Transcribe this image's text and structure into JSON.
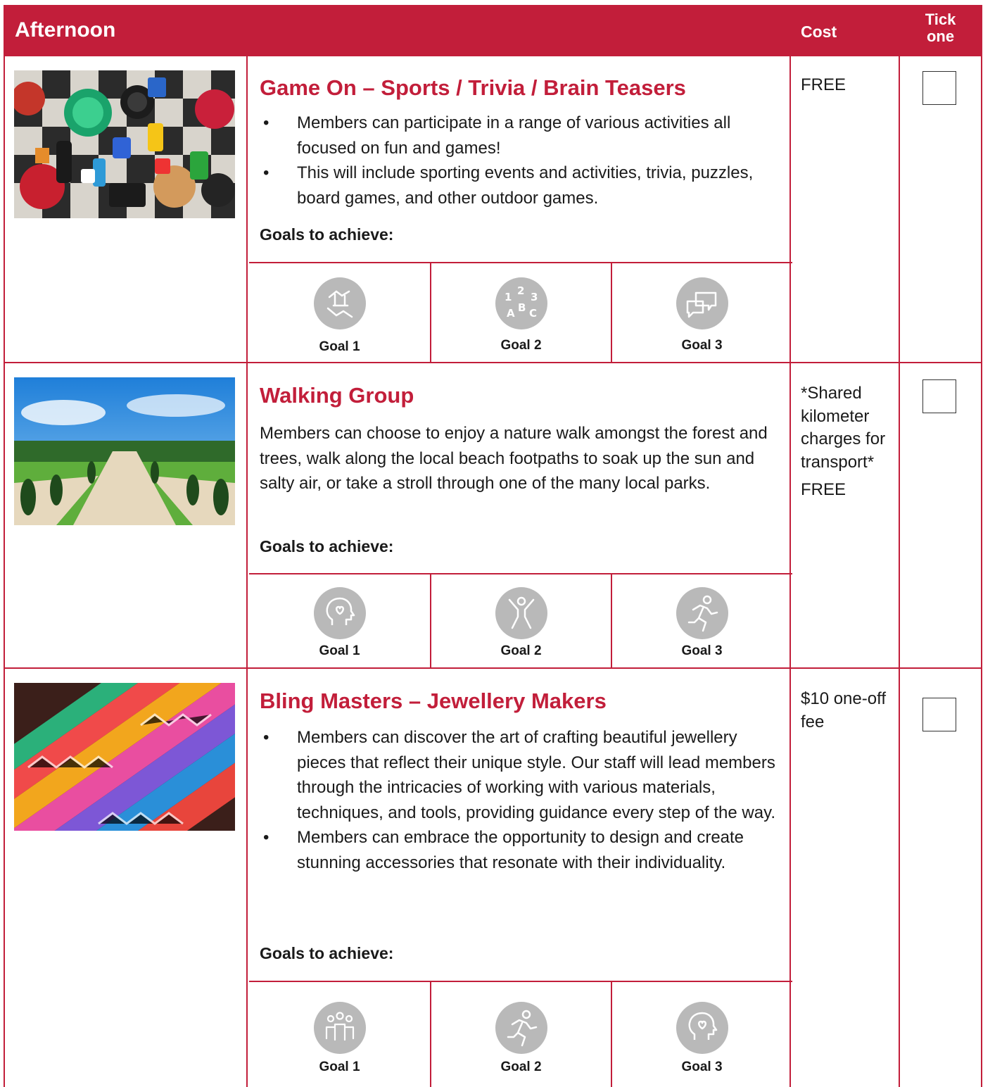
{
  "header": {
    "title": "Afternoon",
    "cost": "Cost",
    "tick_line1": "Tick",
    "tick_line2": "one"
  },
  "activities": [
    {
      "title": "Game On – Sports / Trivia / Brain Teasers",
      "image": "board-games-photo",
      "bullets": [
        "Members can participate in a range of various activities all focused on fun and games!",
        "This will include sporting events and activities, trivia, puzzles, board games, and other outdoor games."
      ],
      "goals_label": "Goals to achieve:",
      "goals": [
        {
          "label": "Goal 1",
          "icon": "joined-hands-icon"
        },
        {
          "label": "Goal 2",
          "icon": "numbers-letters-icon"
        },
        {
          "label": "Goal 3",
          "icon": "speech-bubbles-icon"
        }
      ],
      "cost": [
        "FREE"
      ],
      "checked": false
    },
    {
      "title": "Walking Group",
      "image": "park-path-photo",
      "paragraph": "Members can choose to enjoy a nature walk amongst the forest and trees, walk along the local beach footpaths to soak up the sun and salty air, or take a stroll through one of the many local parks.",
      "goals_label": "Goals to achieve:",
      "goals": [
        {
          "label": "Goal 1",
          "icon": "head-heart-icon"
        },
        {
          "label": "Goal 2",
          "icon": "person-stretch-icon"
        },
        {
          "label": "Goal 3",
          "icon": "running-person-icon"
        }
      ],
      "cost": [
        "*Shared kilometer charges for transport*",
        "FREE"
      ],
      "checked": false
    },
    {
      "title": "Bling Masters – Jewellery Makers",
      "image": "friendship-bracelets-photo",
      "bullets": [
        "Members can discover the art of crafting beautiful jewellery pieces that reflect their unique style. Our staff will lead members through the intricacies of working with various materials, techniques, and tools, providing guidance every step of the way.",
        "Members can embrace the opportunity to design and create stunning accessories that resonate with their individuality."
      ],
      "goals_label": "Goals to achieve:",
      "goals": [
        {
          "label": "Goal 1",
          "icon": "group-people-icon"
        },
        {
          "label": "Goal 2",
          "icon": "running-person-icon"
        },
        {
          "label": "Goal 3",
          "icon": "head-heart-icon"
        }
      ],
      "cost": [
        "$10 one-off fee"
      ],
      "checked": false
    }
  ],
  "colors": {
    "accent": "#c21e3a",
    "icon_grey": "#b9b9b9"
  }
}
